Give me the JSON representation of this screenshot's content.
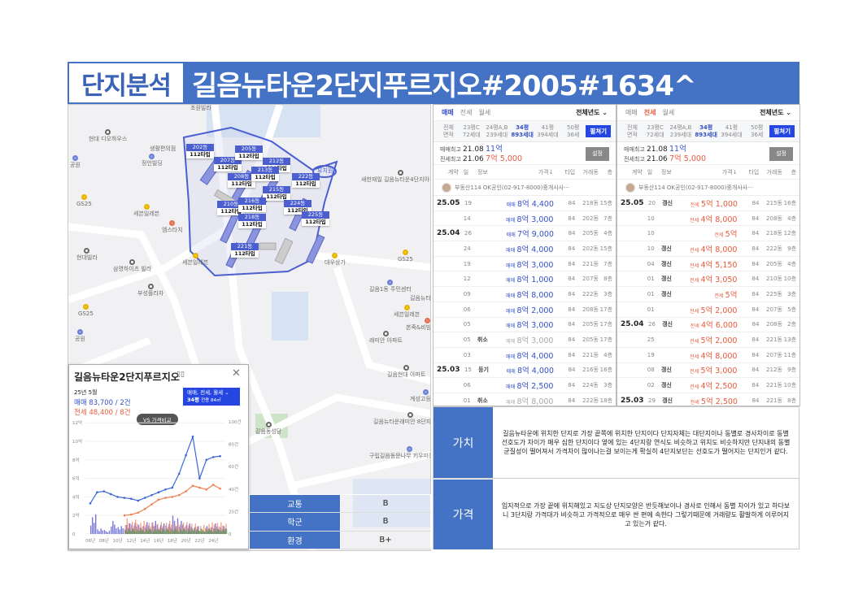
{
  "header": {
    "tag": "단지분석",
    "title": "길음뉴타운2단지푸르지오#2005#1634^"
  },
  "map": {
    "places": [
      "현대 디오하우스",
      "공원",
      "정인빌딩",
      "GS25",
      "세븐일레븐",
      "엠스타치",
      "현대빌라",
      "삼영하이츠 빌라",
      "부성플라자",
      "GS25",
      "공원",
      "초원빌라",
      "생활편의점",
      "새한재일 길음뉴타운4단지아파트",
      "GS25",
      "길음1동 주민센터",
      "세븐일레븐",
      "길음뉴타운 5단지아파트",
      "본죽&비빔밥cafe",
      "래미안 아파트",
      "길음현대 아파트",
      "계성고등학교",
      "길음뉴타운래미안 8단지아파트",
      "구립길음동문나무 키우미동동센터",
      "대우상가",
      "세븐일레븐",
      "길음동성당"
    ],
    "buildings": [
      {
        "dong": "202동",
        "type": "112타입"
      },
      {
        "dong": "207동",
        "type": "112타입"
      },
      {
        "dong": "205동",
        "type": "112타입"
      },
      {
        "dong": "212동",
        "type": "112타입"
      },
      {
        "dong": "208동",
        "type": "112타입"
      },
      {
        "dong": "213동",
        "type": "112타입"
      },
      {
        "dong": "222동",
        "type": "112타입"
      },
      {
        "dong": "215동",
        "type": "112타입"
      },
      {
        "dong": "210동",
        "type": "112타입"
      },
      {
        "dong": "216동",
        "type": "112타입"
      },
      {
        "dong": "224동",
        "type": "112타입"
      },
      {
        "dong": "218동",
        "type": "112타입"
      },
      {
        "dong": "225동",
        "type": "112타입"
      },
      {
        "dong": "221동",
        "type": "112타입"
      }
    ],
    "school_label": "유치원"
  },
  "popup": {
    "title": "길음뉴타운2단지푸르지오",
    "close": "✕",
    "month": "25년 5월",
    "sale": "매매 83,700 / 2건",
    "jeonse": "전세 48,400 / 8건",
    "filter_line1": "매매, 전세, 월세 ⌄",
    "filter_py": "34평",
    "filter_area": "전용 84㎡",
    "compare_btn": "VS 가격비교"
  },
  "chart_data": {
    "type": "line",
    "title": "",
    "x": [
      "06년",
      "07년",
      "08년",
      "09년",
      "10년",
      "11년",
      "12년",
      "13년",
      "14년",
      "15년",
      "16년",
      "17년",
      "18년",
      "19년",
      "20년",
      "21년",
      "22년",
      "23년",
      "24년",
      "25년"
    ],
    "xticks": [
      "06년",
      "08년",
      "10년",
      "12년",
      "14년",
      "16년",
      "18년",
      "20년",
      "22년",
      "24년"
    ],
    "yticks_left": [
      "0",
      "2억",
      "4억",
      "6억",
      "8억",
      "10억",
      "12억"
    ],
    "yticks_right": [
      "0",
      "20건",
      "40건",
      "60건",
      "80건",
      "100건"
    ],
    "ylim_left": [
      0,
      12
    ],
    "ylim_right": [
      0,
      100
    ],
    "series": [
      {
        "name": "매매",
        "color": "#3a66d8",
        "values": [
          3.3,
          4.5,
          4.6,
          4.3,
          4.0,
          3.9,
          3.8,
          3.6,
          3.9,
          4.2,
          4.5,
          4.8,
          5.0,
          6.5,
          8.5,
          10.5,
          6.0,
          8.0,
          8.3,
          8.4
        ]
      },
      {
        "name": "전세",
        "color": "#f08050",
        "values": [
          null,
          null,
          null,
          null,
          null,
          2.0,
          2.1,
          2.3,
          2.7,
          3.2,
          3.7,
          3.9,
          4.0,
          4.2,
          4.6,
          5.2,
          5.0,
          4.8,
          5.3,
          4.9
        ]
      }
    ],
    "volume": [
      {
        "name": "매매 거래량",
        "color": "#4a4ad0",
        "values": [
          15,
          5,
          3,
          10,
          6,
          8,
          10,
          7,
          9,
          10,
          8,
          9,
          14,
          10,
          8,
          6,
          3,
          6,
          8,
          6
        ]
      },
      {
        "name": "전세 거래량",
        "color": "#f08a6a",
        "values": [
          0,
          0,
          0,
          0,
          0,
          12,
          11,
          10,
          10,
          9,
          9,
          10,
          9,
          10,
          9,
          8,
          7,
          9,
          10,
          9
        ]
      },
      {
        "name": "월세 거래량",
        "color": "#3aa040",
        "values": [
          0,
          0,
          0,
          0,
          0,
          4,
          4,
          4,
          4,
          4,
          4,
          4,
          4,
          4,
          4,
          4,
          4,
          4,
          4,
          4
        ]
      }
    ]
  },
  "ratings": [
    {
      "label": "교통",
      "value": "B"
    },
    {
      "label": "학군",
      "value": "B"
    },
    {
      "label": "환경",
      "value": "B+"
    }
  ],
  "panels": [
    {
      "tabs": [
        "매매",
        "전세",
        "월세"
      ],
      "active": 0,
      "year_filter": "전체년도 ⌄",
      "area_label": [
        "전체",
        "면적"
      ],
      "areas": [
        [
          "23평C",
          "72세대"
        ],
        [
          "24평A,B",
          "239세대"
        ],
        [
          "34평",
          "893세대"
        ],
        [
          "41평",
          "394세대"
        ],
        [
          "50평",
          "36세"
        ]
      ],
      "open_btn": "펼쳐기",
      "sale_high_label": "매매최고",
      "sale_high_date": "21.08",
      "sale_high_price": "11억",
      "jeonse_high_label": "전세최고",
      "jeonse_high_date": "21.06",
      "jeonse_high_price": "7억 5,000",
      "setting_btn": "설정",
      "columns": [
        "계약",
        "일",
        "정보",
        "가격↓",
        "타입",
        "거래동",
        "층"
      ],
      "agent": "부동산114 OK공인(02-917-8000)중개사사···",
      "rows": [
        [
          "25.05",
          "19",
          "",
          "매매",
          "8억 4,400",
          "84",
          "218동",
          "15층"
        ],
        [
          "",
          "14",
          "",
          "매매",
          "8억 3,000",
          "84",
          "202동",
          "7층"
        ],
        [
          "25.04",
          "26",
          "",
          "매매",
          "7억 9,000",
          "84",
          "205동",
          "4층"
        ],
        [
          "",
          "24",
          "",
          "매매",
          "8억 4,000",
          "84",
          "202동",
          "15층"
        ],
        [
          "",
          "19",
          "",
          "매매",
          "8억 3,000",
          "84",
          "221동",
          "7층"
        ],
        [
          "",
          "12",
          "",
          "매매",
          "8억 1,000",
          "84",
          "207동",
          "8층"
        ],
        [
          "",
          "09",
          "",
          "매매",
          "8억 8,000",
          "84",
          "222동",
          "3층"
        ],
        [
          "",
          "06",
          "",
          "매매",
          "8억 2,000",
          "84",
          "208동",
          "17층"
        ],
        [
          "",
          "05",
          "",
          "매매",
          "8억 3,000",
          "84",
          "205동",
          "17층"
        ],
        [
          "",
          "05",
          "취소",
          "매매",
          "8억 3,000",
          "84",
          "205동",
          "17층"
        ],
        [
          "",
          "03",
          "",
          "매매",
          "8억 4,000",
          "84",
          "221동",
          "4층"
        ],
        [
          "25.03",
          "15",
          "등기",
          "매매",
          "8억 4,000",
          "84",
          "216동",
          "16층"
        ],
        [
          "",
          "06",
          "",
          "매매",
          "8억 2,500",
          "84",
          "224동",
          "3층"
        ],
        [
          "",
          "01",
          "취소",
          "매매",
          "8억 8,000",
          "84",
          "222동",
          "18층"
        ]
      ]
    },
    {
      "tabs": [
        "매매",
        "전세",
        "월세"
      ],
      "active": 1,
      "year_filter": "전체년도 ⌄",
      "area_label": [
        "전체",
        "면적"
      ],
      "areas": [
        [
          "23평C",
          "72세대"
        ],
        [
          "24평A,B",
          "239세대"
        ],
        [
          "34평",
          "893세대"
        ],
        [
          "41평",
          "394세대"
        ],
        [
          "50평",
          "36세"
        ]
      ],
      "open_btn": "펼쳐기",
      "sale_high_label": "매매최고",
      "sale_high_date": "21.08",
      "sale_high_price": "11억",
      "jeonse_high_label": "전세최고",
      "jeonse_high_date": "21.06",
      "jeonse_high_price": "7억 5,000",
      "setting_btn": "설정",
      "columns": [
        "계약",
        "일",
        "정보",
        "가격↓",
        "타입",
        "거래동",
        "층"
      ],
      "agent": "부동산114 OK공인(02-917-8000)중개사사···",
      "rows": [
        [
          "25.05",
          "20",
          "갱신",
          "전세",
          "5억 1,000",
          "84",
          "215동",
          "16층"
        ],
        [
          "",
          "10",
          "",
          "전세",
          "4억 8,000",
          "84",
          "208동",
          "4층"
        ],
        [
          "",
          "10",
          "",
          "전세",
          "5억",
          "84",
          "218동",
          "12층"
        ],
        [
          "",
          "10",
          "갱신",
          "전세",
          "4억 8,000",
          "84",
          "222동",
          "9층"
        ],
        [
          "",
          "04",
          "갱신",
          "전세",
          "4억 5,150",
          "84",
          "205동",
          "4층"
        ],
        [
          "",
          "01",
          "갱신",
          "전세",
          "4억 3,050",
          "84",
          "210동",
          "10층"
        ],
        [
          "",
          "01",
          "갱신",
          "전세",
          "5억",
          "84",
          "225동",
          "3층"
        ],
        [
          "",
          "01",
          "",
          "전세",
          "5억 2,000",
          "84",
          "207동",
          "5층"
        ],
        [
          "25.04",
          "26",
          "갱신",
          "전세",
          "4억 6,000",
          "84",
          "208동",
          "2층"
        ],
        [
          "",
          "25",
          "",
          "전세",
          "5억 2,000",
          "84",
          "221동",
          "13층"
        ],
        [
          "",
          "19",
          "",
          "전세",
          "4억 8,000",
          "84",
          "207동",
          "11층"
        ],
        [
          "",
          "08",
          "갱신",
          "전세",
          "5억 3,000",
          "84",
          "212동",
          "9층"
        ],
        [
          "",
          "02",
          "갱신",
          "전세",
          "4억 2,500",
          "84",
          "221동",
          "10층"
        ],
        [
          "25.03",
          "29",
          "갱신",
          "전세",
          "5억 2,500",
          "84",
          "221동",
          "8층"
        ]
      ]
    }
  ],
  "evaluation": [
    {
      "label": "가치",
      "text": "길음뉴타운에 위치한 단지로  가장 끝쪽에 위치한 단지이다 단지자체는 대단지이나 동별로 경사차이로  동별 선호도가 차이가 매우 심한 단지이다 옆에 있는 4단지랑 연식도 비슷하고 위치도 비슷하지만 단지내의 동별 균질성이 떨어져서 가격차이 많이나는걸 보이는게 확실히 4단지보단는 선호도가 떨어지는 단지인거 같다."
    },
    {
      "label": "가격",
      "text": "입지적으로  가장 끝에 위치해있고  지도상 단지모양은 반듯해보이나 경사로 인해서  동별 차이가 있고  하다보니 3단지랑 가격대가 비슷하고  가격적으로 매우 싼 편에 속한다 그렇기때문에  거래량도 활발하게 이루어지고 있는거 같다."
    }
  ]
}
